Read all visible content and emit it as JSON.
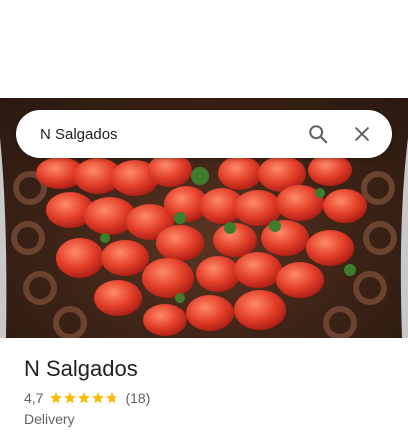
{
  "search": {
    "query": "N Salgados"
  },
  "place": {
    "name": "N Salgados",
    "rating": "4,7",
    "rating_value": 4.7,
    "review_count": "(18)",
    "category": "Delivery"
  },
  "colors": {
    "star": "#fbbc04",
    "star_empty": "#dadce0",
    "icon": "#5f6368"
  },
  "icons": [
    "search-icon",
    "close-icon",
    "star-icon"
  ]
}
